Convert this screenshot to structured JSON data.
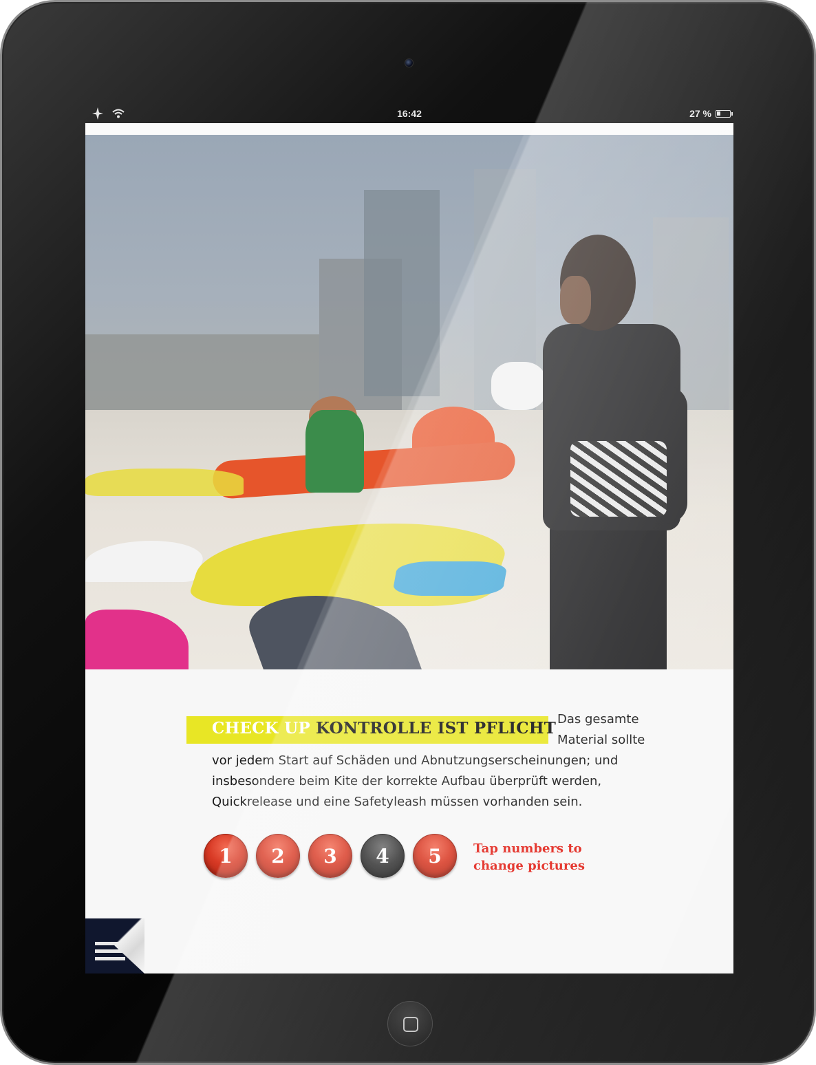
{
  "status_bar": {
    "time": "16:42",
    "battery_text": "27 %",
    "battery_level": 0.27,
    "icons": [
      "airplane-icon",
      "wifi-icon",
      "battery-icon"
    ]
  },
  "article": {
    "headline_kicker": "CHECK UP",
    "headline_title": "KONTROLLE IST PFLICHT",
    "body_side": "Das gesamte Material sollte",
    "body_main": "vor jedem Start auf Schäden und Abnutzungserscheinungen; und insbesondere beim Kite der korrekte Aufbau überprüft werden, Quickrelease und eine Safetyleash müssen vorhanden sein."
  },
  "gallery": {
    "buttons": [
      "1",
      "2",
      "3",
      "4",
      "5"
    ],
    "active_index": 3,
    "hint_line1": "Tap numbers to",
    "hint_line2": "change pictures"
  },
  "colors": {
    "headline_highlight": "#e8e625",
    "button_red": "#d93b26",
    "button_active": "#333333",
    "hint_red": "#e2231a"
  },
  "menu": {
    "icon": "menu-lines-icon"
  }
}
